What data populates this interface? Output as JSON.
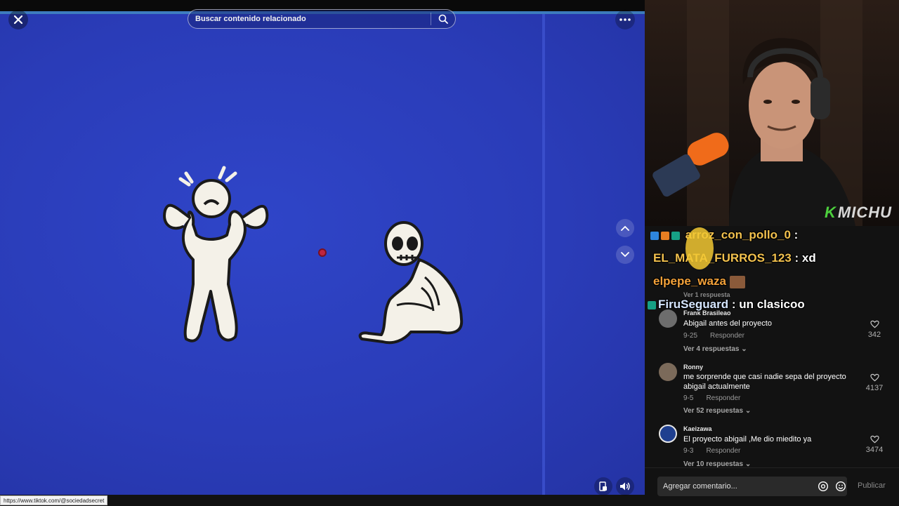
{
  "search": {
    "placeholder": "Buscar contenido relacionado"
  },
  "status_url": "https://www.tiktok.com/@sociedadsecret",
  "overlay": {
    "logo_k": "K",
    "logo_text": "MICHU"
  },
  "stream_chat": [
    {
      "user": "arroz_con_pollo_0",
      "sep": " :",
      "message": "",
      "color": "#f2c14e"
    },
    {
      "user": "EL_MATA_FURROS_123",
      "sep": " :",
      "message": " xd",
      "color": "#f2c14e"
    },
    {
      "user": "elpepe_waza",
      "sep": "",
      "message": "",
      "color": "#f2a13a"
    },
    {
      "user": "FiruSeguard",
      "sep": " :",
      "message": " un clasicoo",
      "color": "#d6e6ff"
    }
  ],
  "comments": [
    {
      "username": "Frank Brasileao",
      "text": "Abigail antes del proyecto",
      "date": "9-25",
      "reply_label": "Responder",
      "replies": "Ver 4 respuestas",
      "likes": "342"
    },
    {
      "username": "Ronny",
      "text": "me sorprende que casi nadie sepa del proyecto abigail actualmente",
      "date": "9-5",
      "reply_label": "Responder",
      "replies": "Ver 52 respuestas",
      "likes": "4137"
    },
    {
      "username": "Kaeizawa",
      "text": "El proyecto abigail ,Me dio miedito ya",
      "date": "9-3",
      "reply_label": "Responder",
      "replies": "Ver 10 respuestas",
      "likes": "3474"
    }
  ],
  "hidden_replies": "Ver 1 respuesta",
  "comment_box": {
    "placeholder": "Agregar comentario...",
    "publish": "Publicar"
  },
  "colors": {
    "video_bg": "#2a3cb8",
    "panel_bg": "#121212",
    "accent_logo": "#4ccf3d",
    "cursor": "#c0253f"
  }
}
